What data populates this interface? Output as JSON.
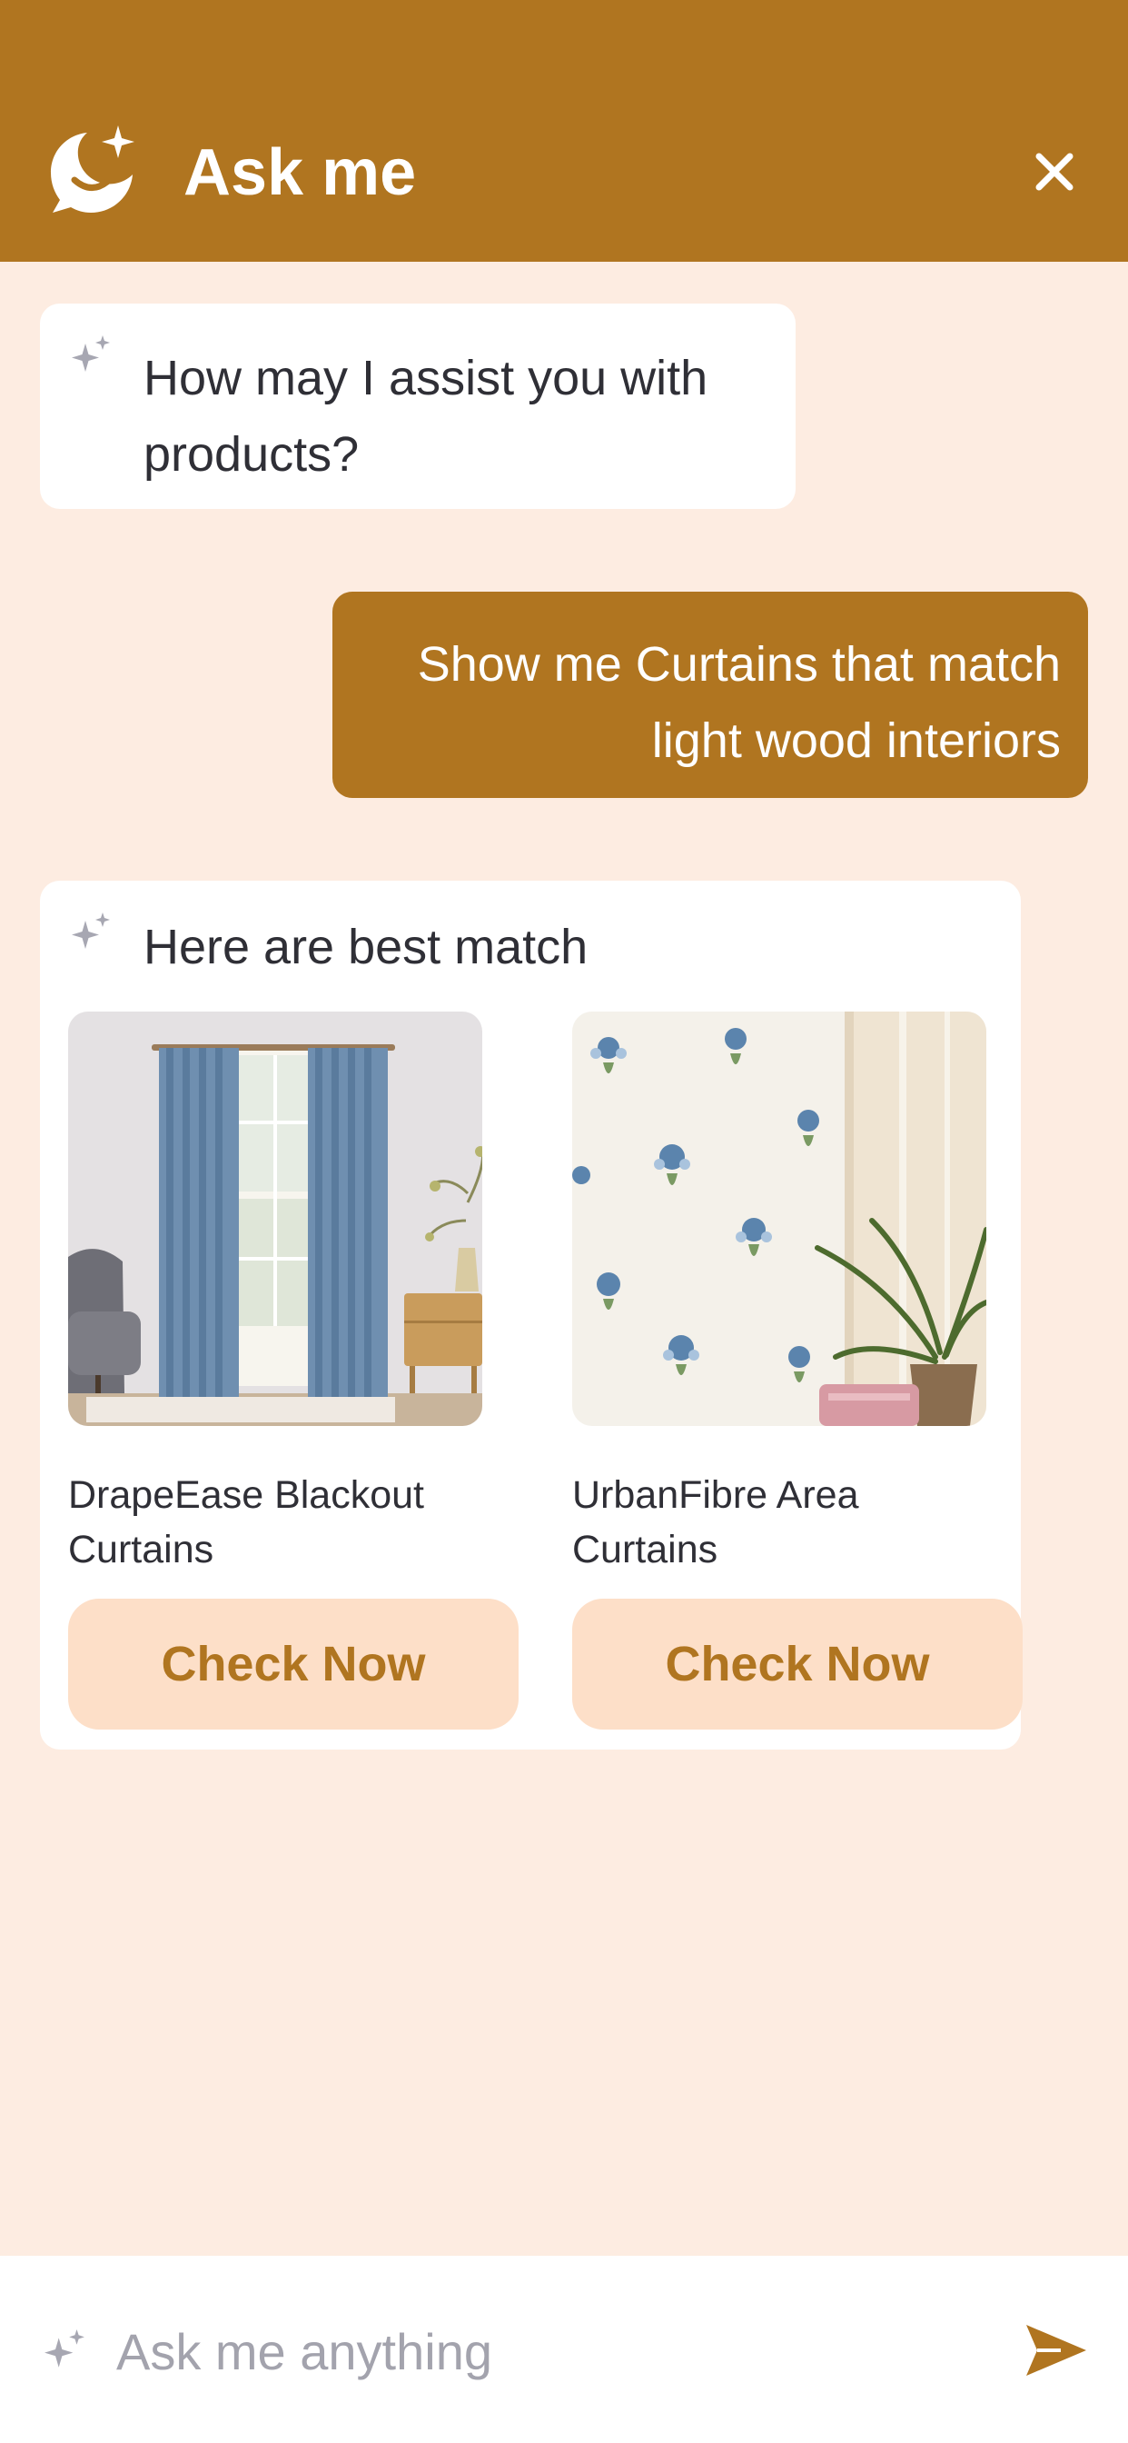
{
  "header": {
    "title": "Ask me",
    "logo_icon": "chat-moon-sparkle-icon",
    "close_icon": "close-icon"
  },
  "colors": {
    "accent": "#b07520",
    "background": "#fdece1",
    "button_bg": "#fddfc8",
    "card_bg": "#ffffff",
    "muted": "#a3a3ad"
  },
  "conversation": {
    "bot_greeting": "How may I assist you with products?",
    "user_query": "Show me Curtains that match light wood interiors",
    "results_title": "Here are best match"
  },
  "products": [
    {
      "name": "DrapeEase Blackout Curtains",
      "button_label": "Check Now"
    },
    {
      "name": "UrbanFibre Area Curtains",
      "button_label": "Check Now"
    }
  ],
  "input": {
    "placeholder": "Ask me anything",
    "value": "",
    "send_icon": "send-icon"
  }
}
